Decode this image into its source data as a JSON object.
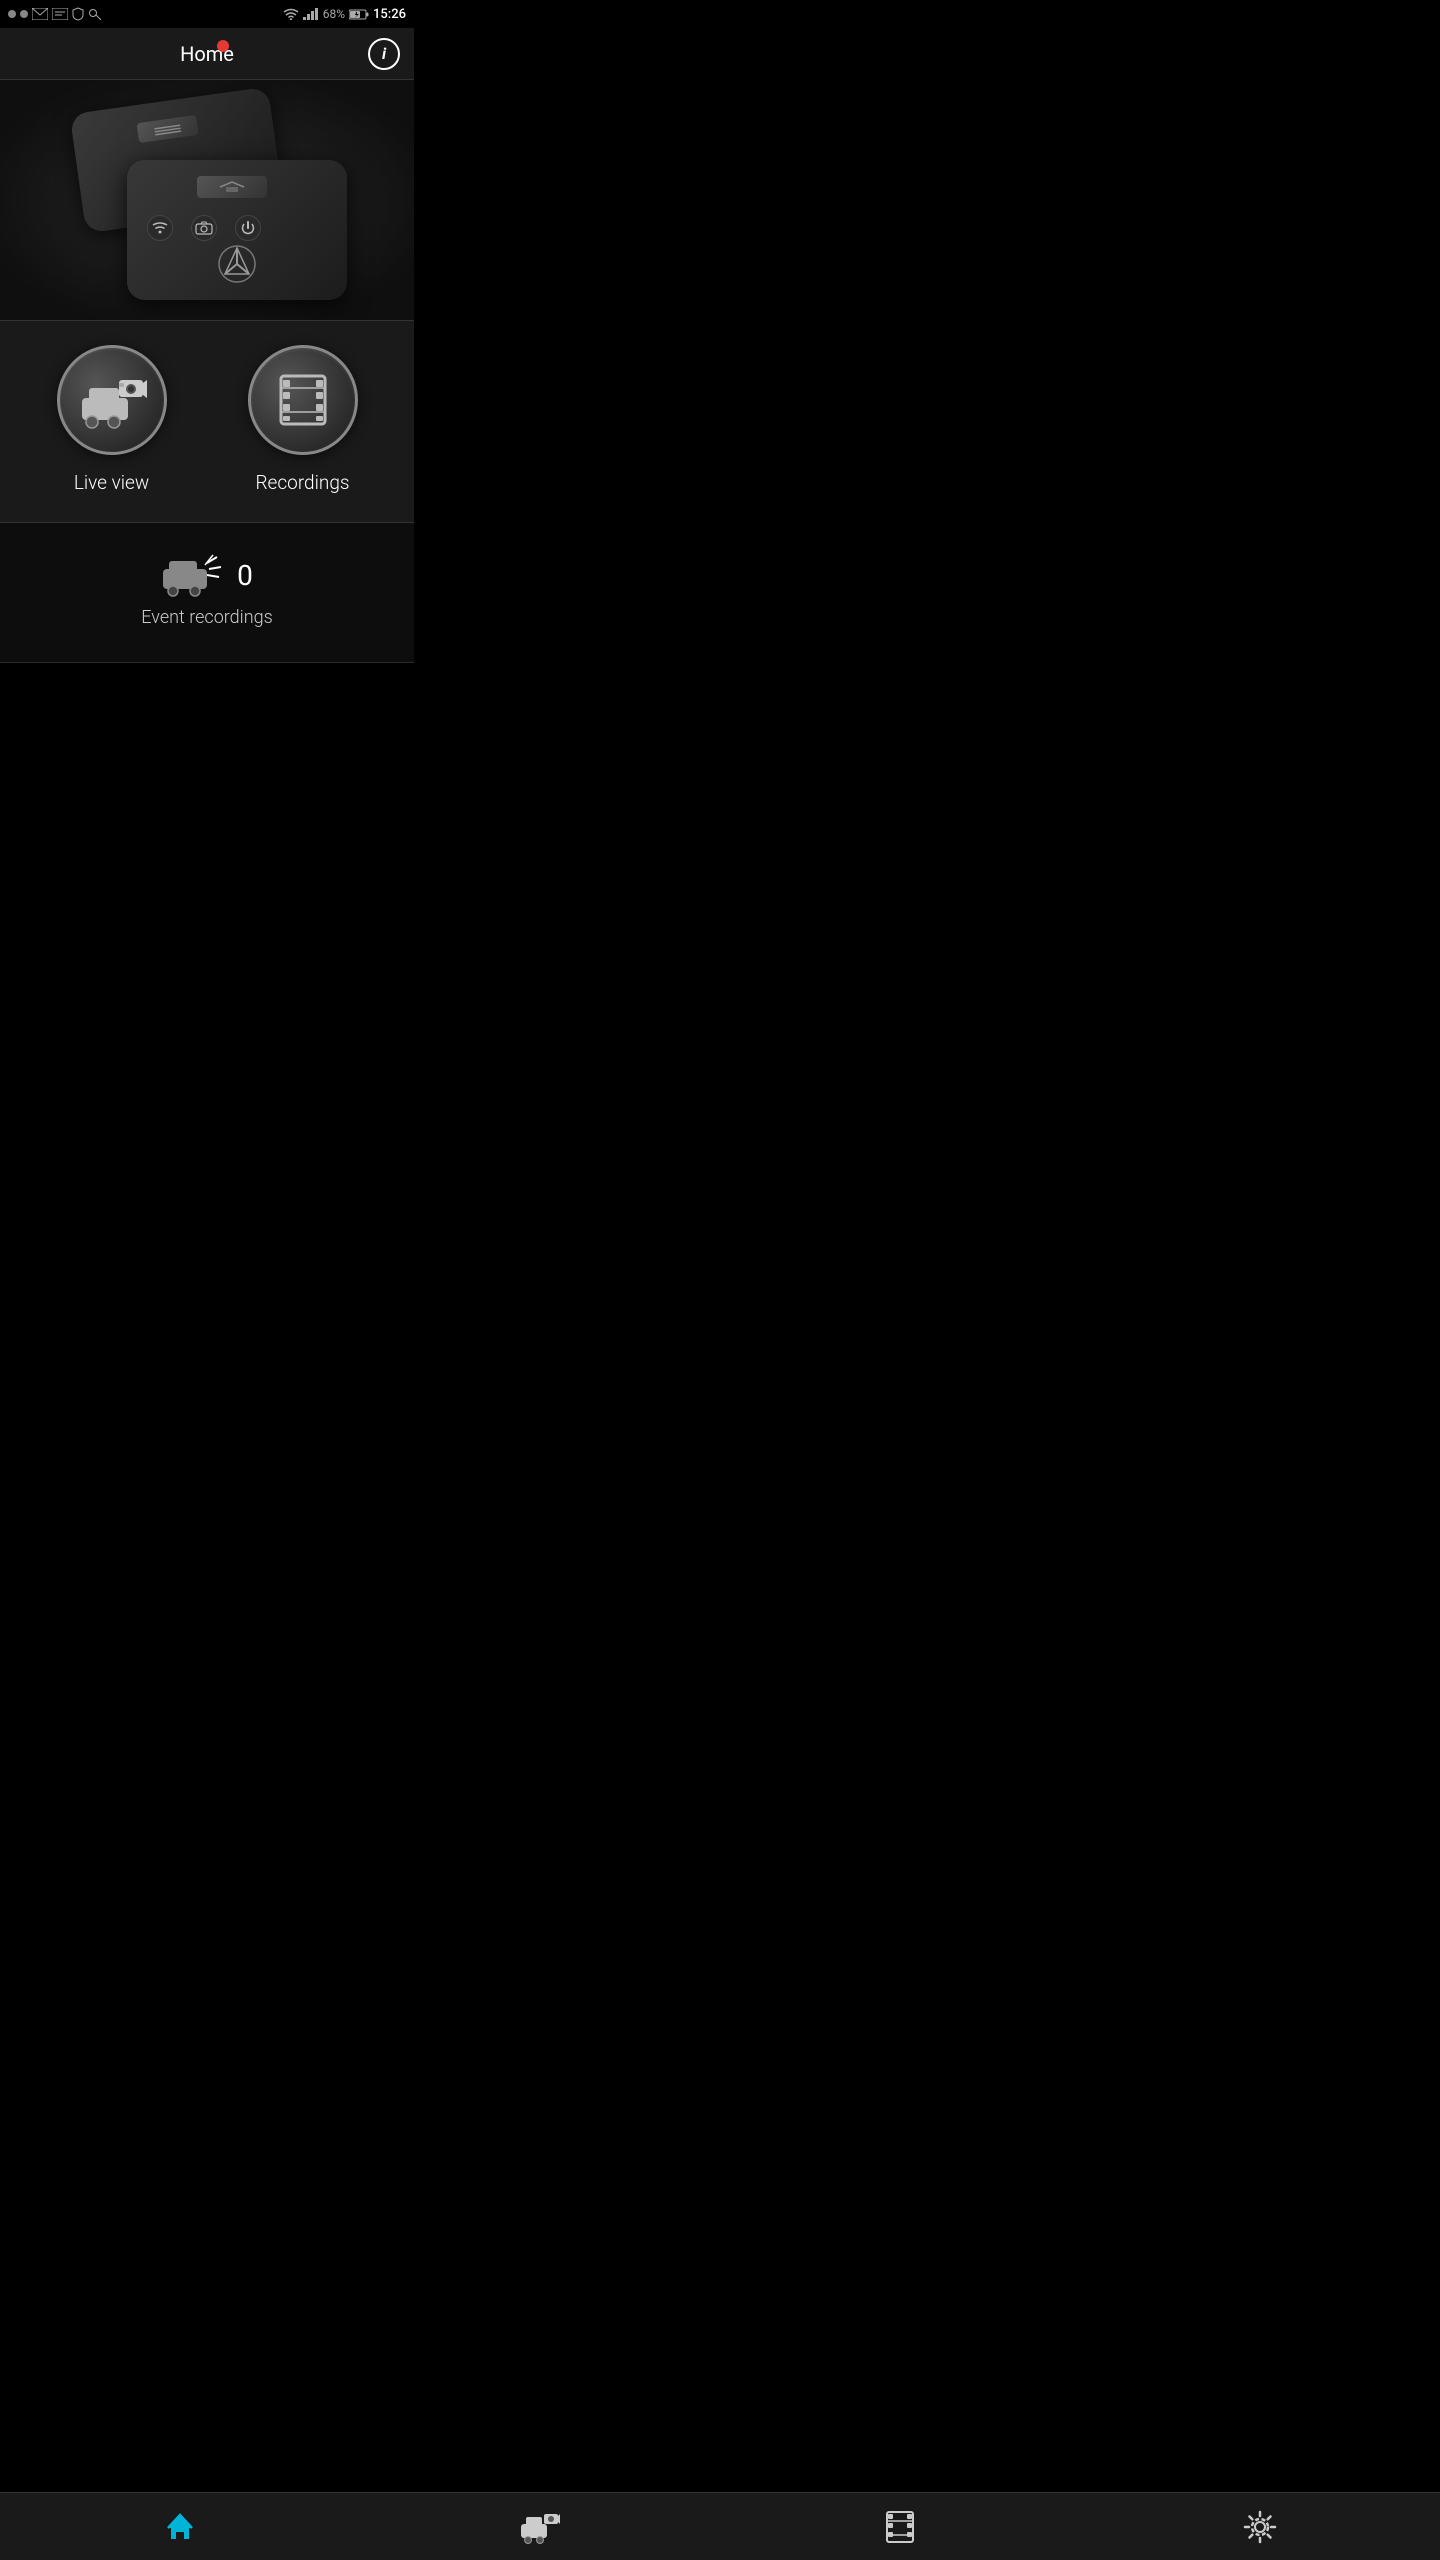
{
  "statusBar": {
    "battery": "68%",
    "time": "15:26",
    "icons": [
      "dots",
      "gmail",
      "email",
      "shield",
      "key"
    ]
  },
  "header": {
    "title": "Home",
    "infoLabel": "i",
    "recordingDot": true
  },
  "deviceImage": {
    "altText": "Mercedes dash cam device"
  },
  "mainButtons": [
    {
      "id": "live-view",
      "label": "Live view",
      "icon": "live-view-icon"
    },
    {
      "id": "recordings",
      "label": "Recordings",
      "icon": "film-strip-icon"
    }
  ],
  "eventSection": {
    "count": "0",
    "label": "Event recordings",
    "iconAlt": "car crash icon"
  },
  "bottomNav": [
    {
      "id": "home",
      "icon": "home-icon",
      "label": "Home",
      "active": true
    },
    {
      "id": "liveview",
      "icon": "liveview-nav-icon",
      "label": "Live view",
      "active": false
    },
    {
      "id": "recordings-nav",
      "icon": "film-nav-icon",
      "label": "Recordings",
      "active": false
    },
    {
      "id": "settings",
      "icon": "settings-icon",
      "label": "Settings",
      "active": false
    }
  ]
}
